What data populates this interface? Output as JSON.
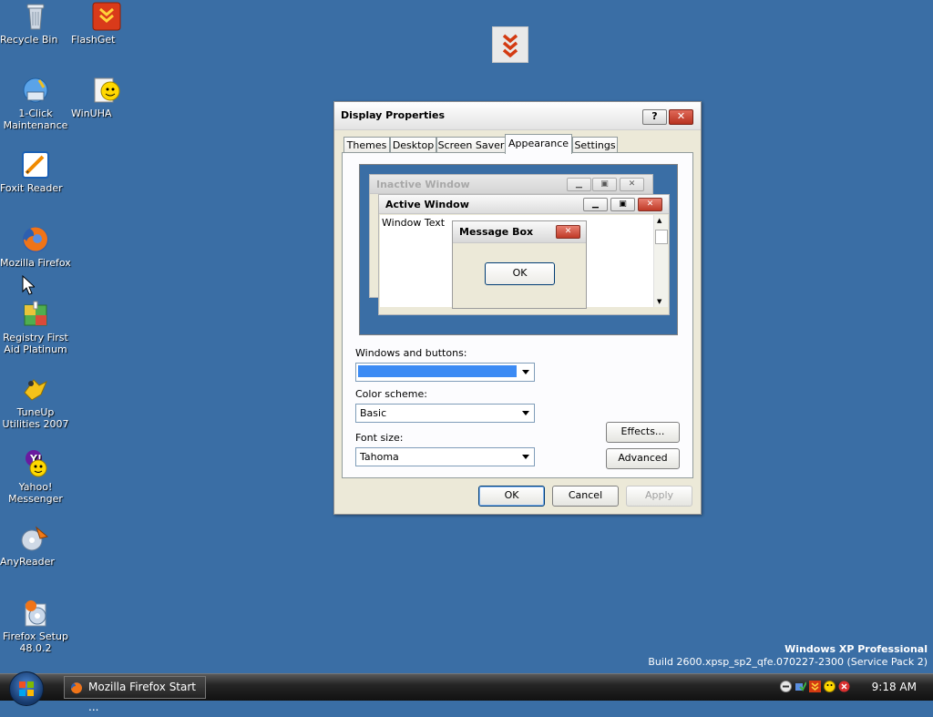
{
  "desktop": {
    "icons": [
      {
        "label": "Recycle Bin",
        "icon": "recycle-bin-icon"
      },
      {
        "label": "FlashGet",
        "icon": "flashget-icon"
      },
      {
        "label": "1-Click Maintenance",
        "icon": "1-click-maintenance-icon"
      },
      {
        "label": "WinUHA",
        "icon": "winuha-icon"
      },
      {
        "label": "Foxit Reader",
        "icon": "foxit-reader-icon"
      },
      {
        "label": "Mozilla Firefox",
        "icon": "firefox-icon"
      },
      {
        "label": "Registry First Aid Platinum",
        "icon": "registry-first-aid-icon"
      },
      {
        "label": "TuneUp Utilities 2007",
        "icon": "tuneup-utilities-icon"
      },
      {
        "label": "Yahoo! Messenger",
        "icon": "yahoo-messenger-icon"
      },
      {
        "label": "AnyReader",
        "icon": "anyreader-icon"
      },
      {
        "label": "Firefox Setup 48.0.2",
        "icon": "firefox-setup-icon"
      }
    ],
    "watermark": {
      "edition": "Windows XP Professional",
      "build": "Build 2600.xpsp_sp2_qfe.070227-2300 (Service Pack 2)"
    }
  },
  "dialog": {
    "title": "Display Properties",
    "help_label": "?",
    "close_label": "✕",
    "tabs": [
      {
        "label": "Themes"
      },
      {
        "label": "Desktop"
      },
      {
        "label": "Screen Saver"
      },
      {
        "label": "Appearance",
        "selected": true
      },
      {
        "label": "Settings"
      }
    ],
    "preview": {
      "inactive_title": "Inactive Window",
      "active_title": "Active Window",
      "window_text": "Window Text",
      "message_box_title": "Message Box",
      "message_box_ok": "OK"
    },
    "windows_and_buttons": {
      "label": "Windows and buttons:",
      "value": ""
    },
    "color_scheme": {
      "label": "Color scheme:",
      "value": "Basic"
    },
    "font_size": {
      "label": "Font size:",
      "value": "Tahoma"
    },
    "buttons": {
      "effects": "Effects...",
      "advanced": "Advanced",
      "ok": "OK",
      "cancel": "Cancel",
      "apply": "Apply"
    }
  },
  "taskbar": {
    "task_label": "Mozilla Firefox Start ...",
    "clock": "9:18 AM"
  },
  "colors": {
    "desktop_bg": "#3a6ea5",
    "dialog_bg": "#ece9d8",
    "selection_blue": "#3c8bf4",
    "close_red": "#c0392b"
  }
}
